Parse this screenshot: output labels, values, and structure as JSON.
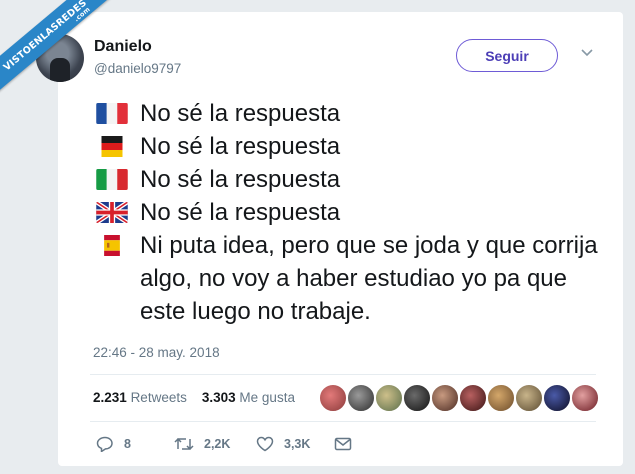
{
  "watermark": {
    "text": "VISTOENLASREDES",
    "suffix": ".com"
  },
  "author": {
    "name": "Danielo",
    "handle": "@danielo9797"
  },
  "follow_button": "Seguir",
  "tweet_lines": [
    {
      "flag": "france-flag-icon",
      "text": "No sé la respuesta"
    },
    {
      "flag": "germany-flag-icon",
      "text": "No sé la respuesta"
    },
    {
      "flag": "italy-flag-icon",
      "text": "No sé la respuesta"
    },
    {
      "flag": "uk-flag-icon",
      "text": "No sé la respuesta"
    },
    {
      "flag": "spain-flag-icon",
      "text": "Ni puta idea, pero que se joda y que corrija algo, no voy a haber estudiao yo pa que este luego no trabaje."
    }
  ],
  "timestamp": "22:46 - 28 may. 2018",
  "stats": {
    "retweets_count": "2.231",
    "retweets_label": "Retweets",
    "likes_count": "3.303",
    "likes_label": "Me gusta"
  },
  "likers_avatars": [
    "liker-avatar",
    "liker-avatar",
    "liker-avatar",
    "liker-avatar",
    "liker-avatar",
    "liker-avatar",
    "liker-avatar",
    "liker-avatar",
    "liker-avatar",
    "liker-avatar"
  ],
  "actions": {
    "replies": "8",
    "retweets": "2,2K",
    "likes": "3,3K"
  },
  "colors": {
    "accent": "#4c3eb6",
    "muted": "#657786",
    "watermark": "#2a86c8"
  }
}
